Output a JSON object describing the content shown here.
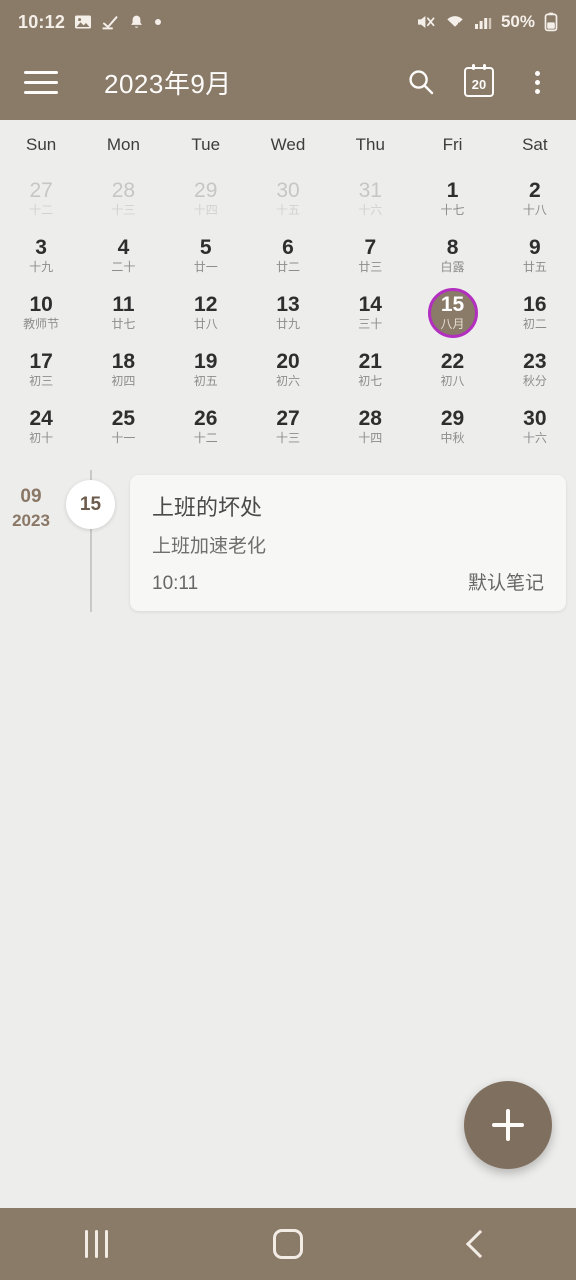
{
  "status_bar": {
    "clock": "10:12",
    "battery_percent": "50%",
    "left_icons": [
      "image-icon",
      "download-complete-icon",
      "notification-bell-icon",
      "dot-icon"
    ],
    "right_icons": [
      "mute-icon",
      "wifi-icon",
      "signal-bars-icon",
      "battery-icon"
    ]
  },
  "app_bar": {
    "menu_icon": "hamburger-menu-icon",
    "title": "2023年9月",
    "search_icon": "search-icon",
    "today_icon": "calendar-today-icon",
    "today_number": "20",
    "overflow_icon": "overflow-menu-icon"
  },
  "calendar": {
    "weekdays": [
      "Sun",
      "Mon",
      "Tue",
      "Wed",
      "Thu",
      "Fri",
      "Sat"
    ],
    "selected_day": "15",
    "accent_ring_color": "#b32fc0",
    "accent_fill_color": "#8a7a68",
    "days": [
      {
        "d": "27",
        "l": "十二",
        "out": true
      },
      {
        "d": "28",
        "l": "十三",
        "out": true
      },
      {
        "d": "29",
        "l": "十四",
        "out": true
      },
      {
        "d": "30",
        "l": "十五",
        "out": true
      },
      {
        "d": "31",
        "l": "十六",
        "out": true
      },
      {
        "d": "1",
        "l": "十七",
        "out": false
      },
      {
        "d": "2",
        "l": "十八",
        "out": false
      },
      {
        "d": "3",
        "l": "十九",
        "out": false
      },
      {
        "d": "4",
        "l": "二十",
        "out": false
      },
      {
        "d": "5",
        "l": "廿一",
        "out": false
      },
      {
        "d": "6",
        "l": "廿二",
        "out": false
      },
      {
        "d": "7",
        "l": "廿三",
        "out": false
      },
      {
        "d": "8",
        "l": "白露",
        "out": false
      },
      {
        "d": "9",
        "l": "廿五",
        "out": false
      },
      {
        "d": "10",
        "l": "教师节",
        "out": false
      },
      {
        "d": "11",
        "l": "廿七",
        "out": false
      },
      {
        "d": "12",
        "l": "廿八",
        "out": false
      },
      {
        "d": "13",
        "l": "廿九",
        "out": false
      },
      {
        "d": "14",
        "l": "三十",
        "out": false
      },
      {
        "d": "15",
        "l": "八月",
        "out": false,
        "selected": true
      },
      {
        "d": "16",
        "l": "初二",
        "out": false
      },
      {
        "d": "17",
        "l": "初三",
        "out": false
      },
      {
        "d": "18",
        "l": "初四",
        "out": false
      },
      {
        "d": "19",
        "l": "初五",
        "out": false
      },
      {
        "d": "20",
        "l": "初六",
        "out": false
      },
      {
        "d": "21",
        "l": "初七",
        "out": false
      },
      {
        "d": "22",
        "l": "初八",
        "out": false
      },
      {
        "d": "23",
        "l": "秋分",
        "out": false
      },
      {
        "d": "24",
        "l": "初十",
        "out": false
      },
      {
        "d": "25",
        "l": "十一",
        "out": false
      },
      {
        "d": "26",
        "l": "十二",
        "out": false
      },
      {
        "d": "27",
        "l": "十三",
        "out": false
      },
      {
        "d": "28",
        "l": "十四",
        "out": false
      },
      {
        "d": "29",
        "l": "中秋",
        "out": false
      },
      {
        "d": "30",
        "l": "十六",
        "out": false
      }
    ]
  },
  "agenda": {
    "month": "09",
    "year": "2023",
    "day_bubble": "15",
    "event": {
      "title": "上班的坏处",
      "subtitle": "上班加速老化",
      "time": "10:11",
      "notebook": "默认笔记"
    }
  },
  "fab": {
    "icon": "plus-icon",
    "color": "#7f6f5f"
  },
  "nav_bar": {
    "recents_icon": "recents-icon",
    "home_icon": "home-icon",
    "back_icon": "back-icon"
  }
}
